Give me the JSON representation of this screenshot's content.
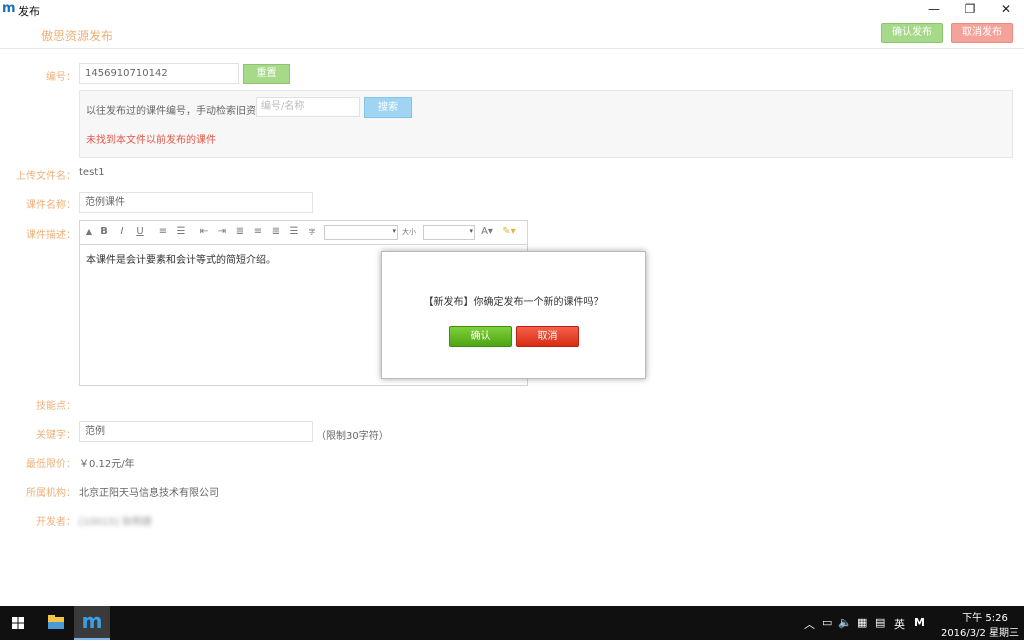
{
  "window": {
    "logo": "m",
    "title": "发布",
    "minimize": "—",
    "restore": "❐",
    "close": "✕"
  },
  "header": {
    "title": "傲思资源发布",
    "confirm_label": "确认发布",
    "cancel_label": "取消发布"
  },
  "form": {
    "code_label": "编号：",
    "code_value": "1456910710142",
    "reset_label": "重置",
    "search_hint": "以往发布过的课件编号，手动检索旧资源：",
    "search_placeholder": "编号/名称",
    "search_label": "搜索",
    "not_found": "未找到本文件以前发布的课件",
    "file_label": "上传文件名：",
    "file_value": "test1",
    "name_label": "课件名称：",
    "name_value": "范例课件",
    "desc_label": "课件描述：",
    "desc_value": "本课件是会计要素和会计等式的简短介绍。",
    "knowledge_label": "技能点：",
    "keyword_label": "关键字：",
    "keyword_value": "范例",
    "keyword_limit": "（限制30字符）",
    "price_label": "最低限价：",
    "price_value": "￥0.12元/年",
    "org_label": "所属机构：",
    "org_value": "北京正阳天马信息技术有限公司",
    "dev_label": "开发者：",
    "dev_value": "[10015] 张明德"
  },
  "toolbar": {
    "bold": "B",
    "italic": "I",
    "underline": "U",
    "font_size_label": "大小"
  },
  "dialog": {
    "message": "【新发布】你确定发布一个新的课件吗？",
    "ok_label": "确认",
    "cancel_label": "取消"
  },
  "taskbar": {
    "ime": "英",
    "clock_time": "下午 5:26",
    "clock_date": "2016/3/2 星期三"
  },
  "colors": {
    "accent_label": "#f0b07a",
    "confirm_green": "#4ea413",
    "cancel_red": "#d82b14"
  }
}
